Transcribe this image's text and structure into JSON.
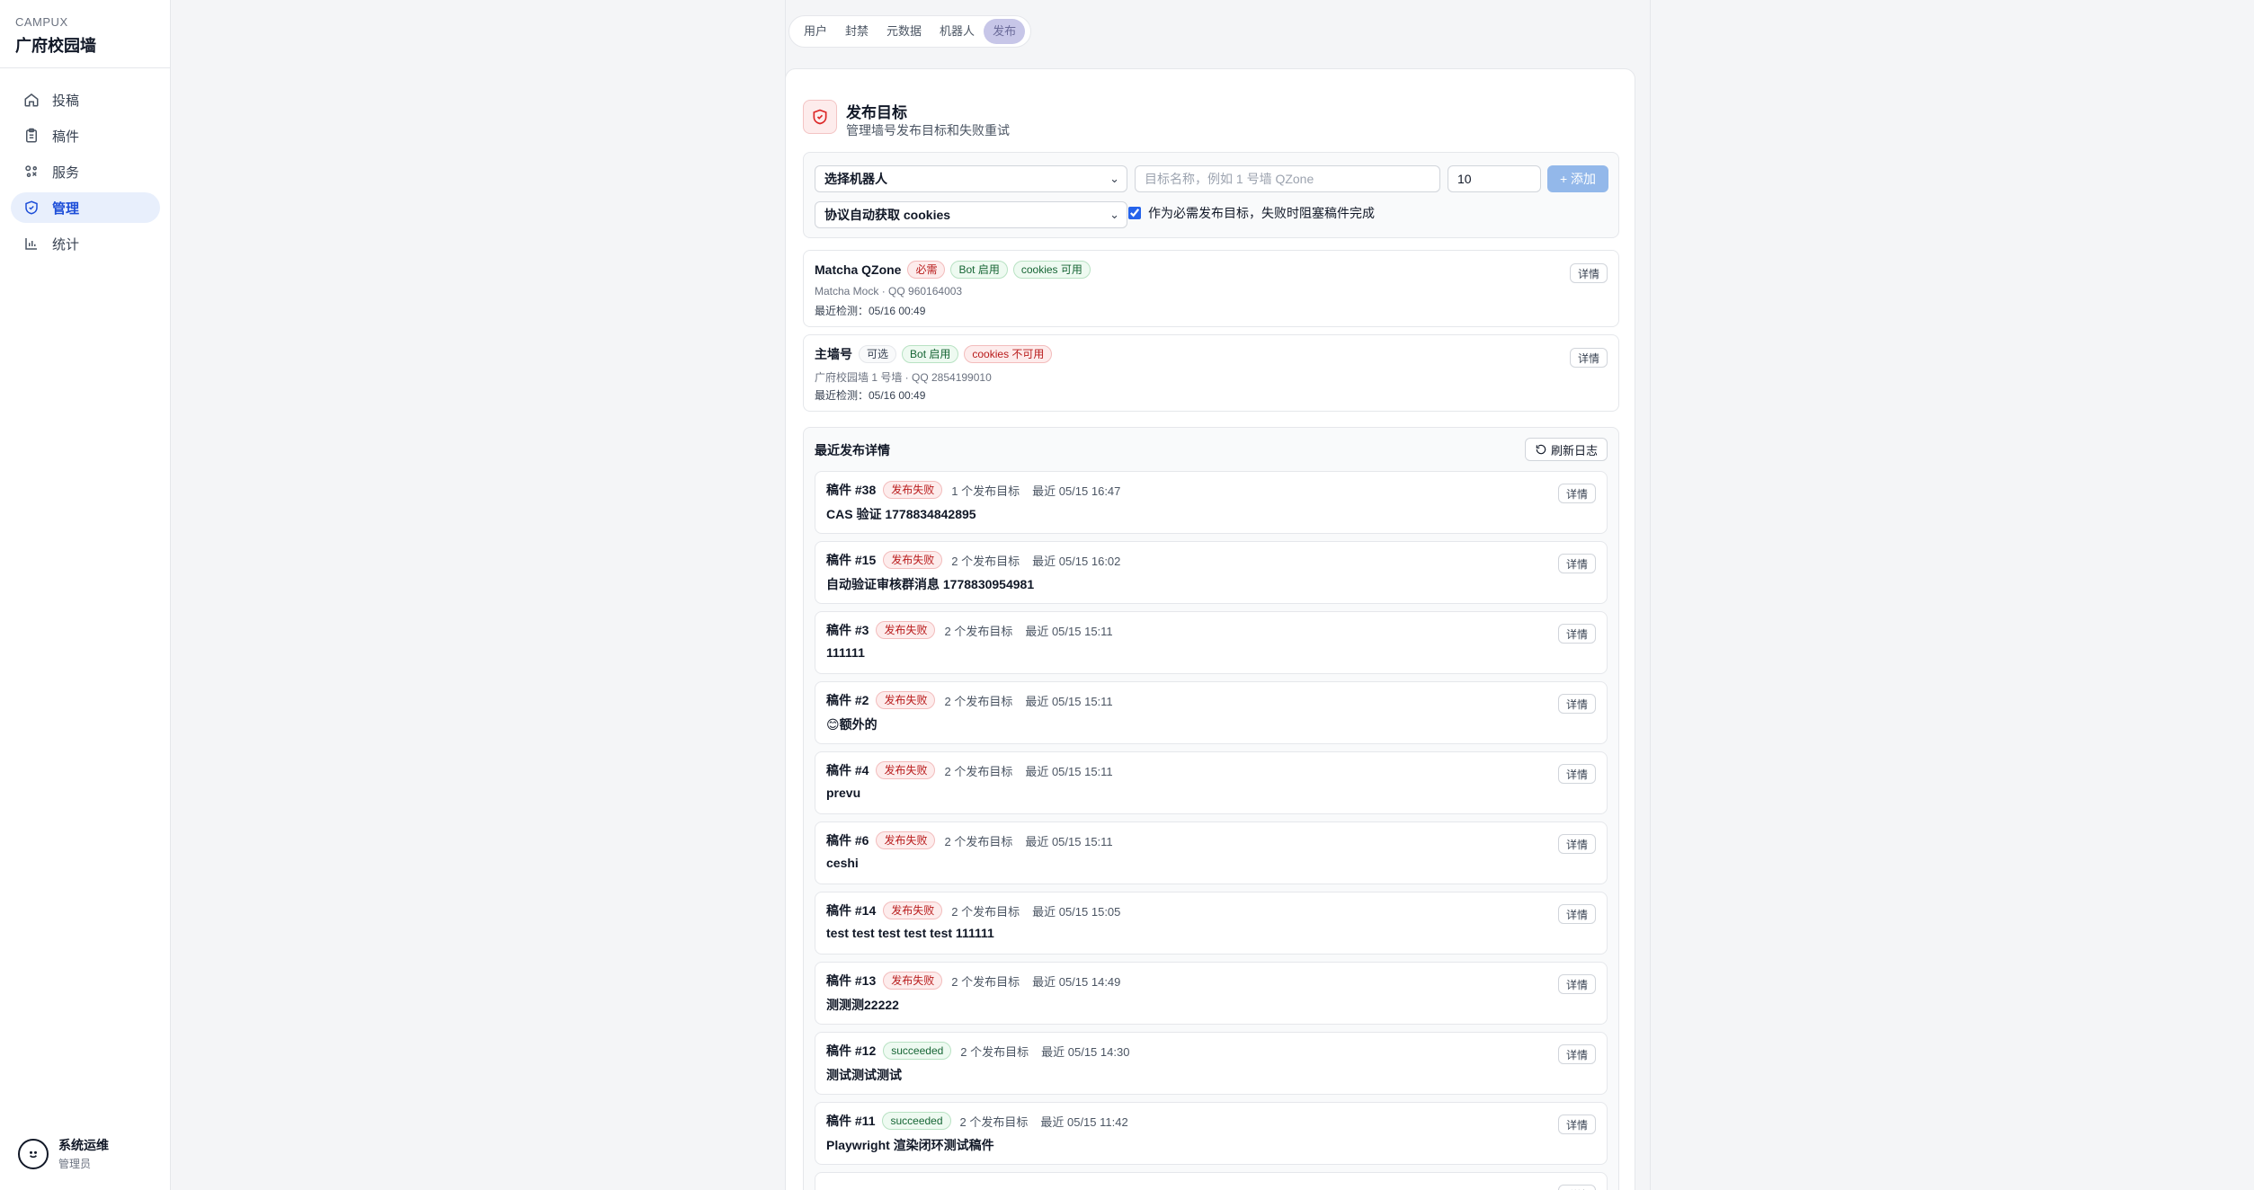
{
  "sidebar": {
    "brand_top": "CAMPUX",
    "brand_name": "广府校园墙",
    "items": [
      {
        "label": "投稿",
        "icon": "home-icon"
      },
      {
        "label": "稿件",
        "icon": "clipboard-icon"
      },
      {
        "label": "服务",
        "icon": "puzzle-icon"
      },
      {
        "label": "管理",
        "icon": "shield-icon",
        "active": true
      },
      {
        "label": "统计",
        "icon": "bar-chart-icon"
      }
    ],
    "user": {
      "name": "系统运维",
      "role": "管理员"
    }
  },
  "tabs": [
    {
      "label": "用户"
    },
    {
      "label": "封禁"
    },
    {
      "label": "元数据"
    },
    {
      "label": "机器人"
    },
    {
      "label": "发布",
      "active": true
    }
  ],
  "header": {
    "title": "发布目标",
    "subtitle": "管理墙号发布目标和失败重试"
  },
  "form": {
    "bot_select": "选择机器人",
    "name_placeholder": "目标名称，例如 1 号墙 QZone",
    "priority_value": "10",
    "add_label": "+ 添加",
    "cookie_select": "协议自动获取 cookies",
    "required_label": "作为必需发布目标，失败时阻塞稿件完成"
  },
  "targets": [
    {
      "name": "Matcha QZone",
      "badges": [
        {
          "text": "必需",
          "color": "red"
        },
        {
          "text": "Bot 启用",
          "color": "green"
        },
        {
          "text": "cookies 可用",
          "color": "green"
        }
      ],
      "sub": "Matcha Mock · QQ 960164003",
      "time": "最近检测：05/16 00:49",
      "detail": "详情"
    },
    {
      "name": "主墙号",
      "badges": [
        {
          "text": "可选",
          "color": "gray"
        },
        {
          "text": "Bot 启用",
          "color": "green"
        },
        {
          "text": "cookies 不可用",
          "color": "red"
        }
      ],
      "sub": "广府校园墙 1 号墙 · QQ 2854199010",
      "time": "最近检测：05/16 00:49",
      "detail": "详情"
    }
  ],
  "recent": {
    "title": "最近发布详情",
    "refresh_label": "刷新日志",
    "logs": [
      {
        "id": "稿件 #38",
        "status": "发布失败",
        "color": "red",
        "count": "1 个发布目标",
        "time": "最近 05/15 16:47",
        "text": "CAS 验证 1778834842895",
        "detail": "详情"
      },
      {
        "id": "稿件 #15",
        "status": "发布失败",
        "color": "red",
        "count": "2 个发布目标",
        "time": "最近 05/15 16:02",
        "text": "自动验证审核群消息 1778830954981",
        "detail": "详情"
      },
      {
        "id": "稿件 #3",
        "status": "发布失败",
        "color": "red",
        "count": "2 个发布目标",
        "time": "最近 05/15 15:11",
        "text": "111111",
        "detail": "详情"
      },
      {
        "id": "稿件 #2",
        "status": "发布失败",
        "color": "red",
        "count": "2 个发布目标",
        "time": "最近 05/15 15:11",
        "text": "😊额外的",
        "detail": "详情"
      },
      {
        "id": "稿件 #4",
        "status": "发布失败",
        "color": "red",
        "count": "2 个发布目标",
        "time": "最近 05/15 15:11",
        "text": "prevu",
        "detail": "详情"
      },
      {
        "id": "稿件 #6",
        "status": "发布失败",
        "color": "red",
        "count": "2 个发布目标",
        "time": "最近 05/15 15:11",
        "text": "ceshi",
        "detail": "详情"
      },
      {
        "id": "稿件 #14",
        "status": "发布失败",
        "color": "red",
        "count": "2 个发布目标",
        "time": "最近 05/15 15:05",
        "text": "test test test test test 111111",
        "detail": "详情"
      },
      {
        "id": "稿件 #13",
        "status": "发布失败",
        "color": "red",
        "count": "2 个发布目标",
        "time": "最近 05/15 14:49",
        "text": "测测测22222",
        "detail": "详情"
      },
      {
        "id": "稿件 #12",
        "status": "succeeded",
        "color": "green",
        "count": "2 个发布目标",
        "time": "最近 05/15 14:30",
        "text": "测试测试测试",
        "detail": "详情"
      },
      {
        "id": "稿件 #11",
        "status": "succeeded",
        "color": "green",
        "count": "2 个发布目标",
        "time": "最近 05/15 11:42",
        "text": "Playwright 渲染闭环测试稿件",
        "detail": "详情"
      },
      {
        "id": "",
        "status": "",
        "color": "green",
        "count": "",
        "time": "",
        "text": "",
        "detail": "详情"
      }
    ]
  },
  "colors": {
    "accent": "#1d4ed8",
    "danger": "#b91c1c",
    "success": "#166534"
  }
}
